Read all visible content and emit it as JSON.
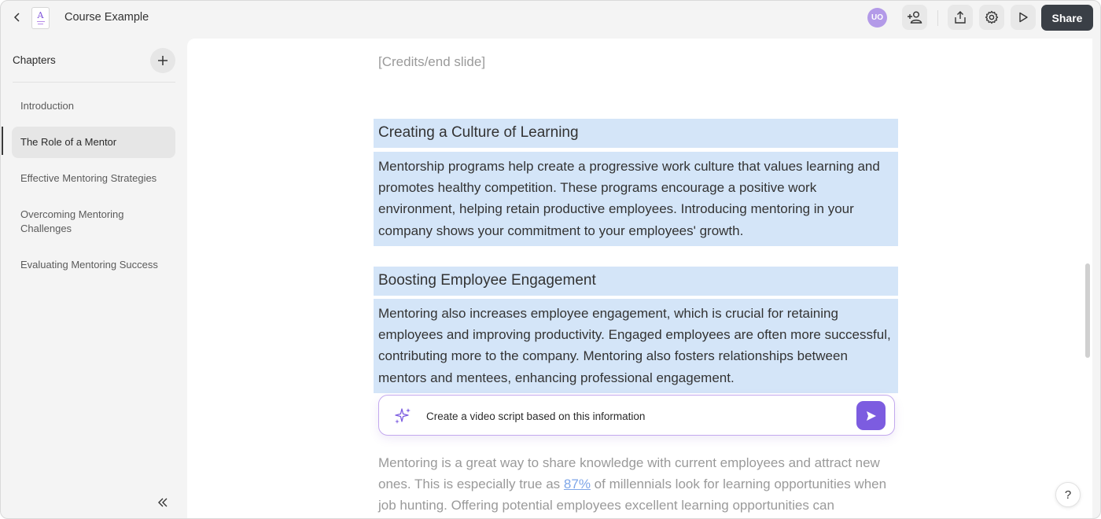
{
  "header": {
    "title": "Course Example",
    "doc_icon_letter": "A",
    "avatar_initials": "UO",
    "share_label": "Share",
    "icons": [
      "chevron-left-icon",
      "document-icon",
      "add-user-icon",
      "export-icon",
      "gear-icon",
      "play-icon"
    ]
  },
  "sidebar": {
    "title": "Chapters",
    "items": [
      {
        "label": "Introduction",
        "active": false
      },
      {
        "label": "The Role of a Mentor",
        "active": true
      },
      {
        "label": "Effective Mentoring Strategies",
        "active": false
      },
      {
        "label": "Overcoming Mentoring Challenges",
        "active": false
      },
      {
        "label": "Evaluating Mentoring Success",
        "active": false
      }
    ]
  },
  "editor": {
    "credits": "[Credits/end slide]",
    "sections": [
      {
        "heading": "Creating a Culture of Learning",
        "body": "Mentorship programs help create a progressive work culture that values learning and promotes healthy competition. These programs encourage a positive work environment, helping retain productive employees. Introducing mentoring in your company shows your commitment to your employees' growth."
      },
      {
        "heading": "Boosting Employee Engagement",
        "body": "Mentoring also increases employee engagement, which is crucial for retaining employees and improving productivity. Engaged employees are often more successful, contributing more to the company. Mentoring also fosters relationships between mentors and mentees, enhancing professional engagement."
      }
    ],
    "ai_prompt": {
      "value": "Create a video script based on this information"
    },
    "faded_paragraph": {
      "before": "Mentoring is a great way to share knowledge with current employees and attract new ones. This is especially true as ",
      "link": "87%",
      "after": " of millennials look for learning opportunities when job hunting. Offering potential employees excellent learning opportunities can"
    }
  },
  "help_label": "?",
  "colors": {
    "accent": "#7c5ce0",
    "selection": "#d4e5f8",
    "share_bg": "#3a3f46",
    "avatar_bg": "#b39ae8"
  }
}
